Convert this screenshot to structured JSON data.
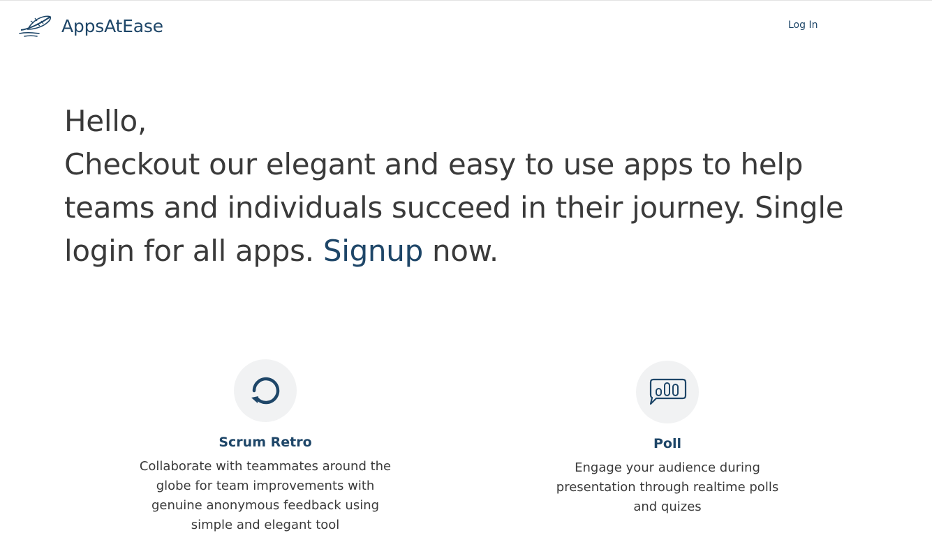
{
  "header": {
    "brand": "AppsAtEase",
    "brand_icon": "feather-icon",
    "login_label": "Log In"
  },
  "hero": {
    "greeting": "Hello,",
    "text_before_link": "Checkout our elegant and easy to use apps to help teams and individuals succeed in their journey. Single login for all apps. ",
    "signup_label": "Signup",
    "text_after_link": " now."
  },
  "apps": [
    {
      "icon": "refresh-cycle-icon",
      "title": "Scrum Retro",
      "description": "Collaborate with teammates around the globe for team improvements with genuine anonymous feedback using simple and elegant tool"
    },
    {
      "icon": "poll-chat-icon",
      "title": "Poll",
      "description": "Engage your audience during presentation through realtime polls and quizes"
    }
  ],
  "colors": {
    "brand": "#1e4668",
    "text": "#3a3a3a",
    "icon_bg": "#f1f2f3"
  }
}
